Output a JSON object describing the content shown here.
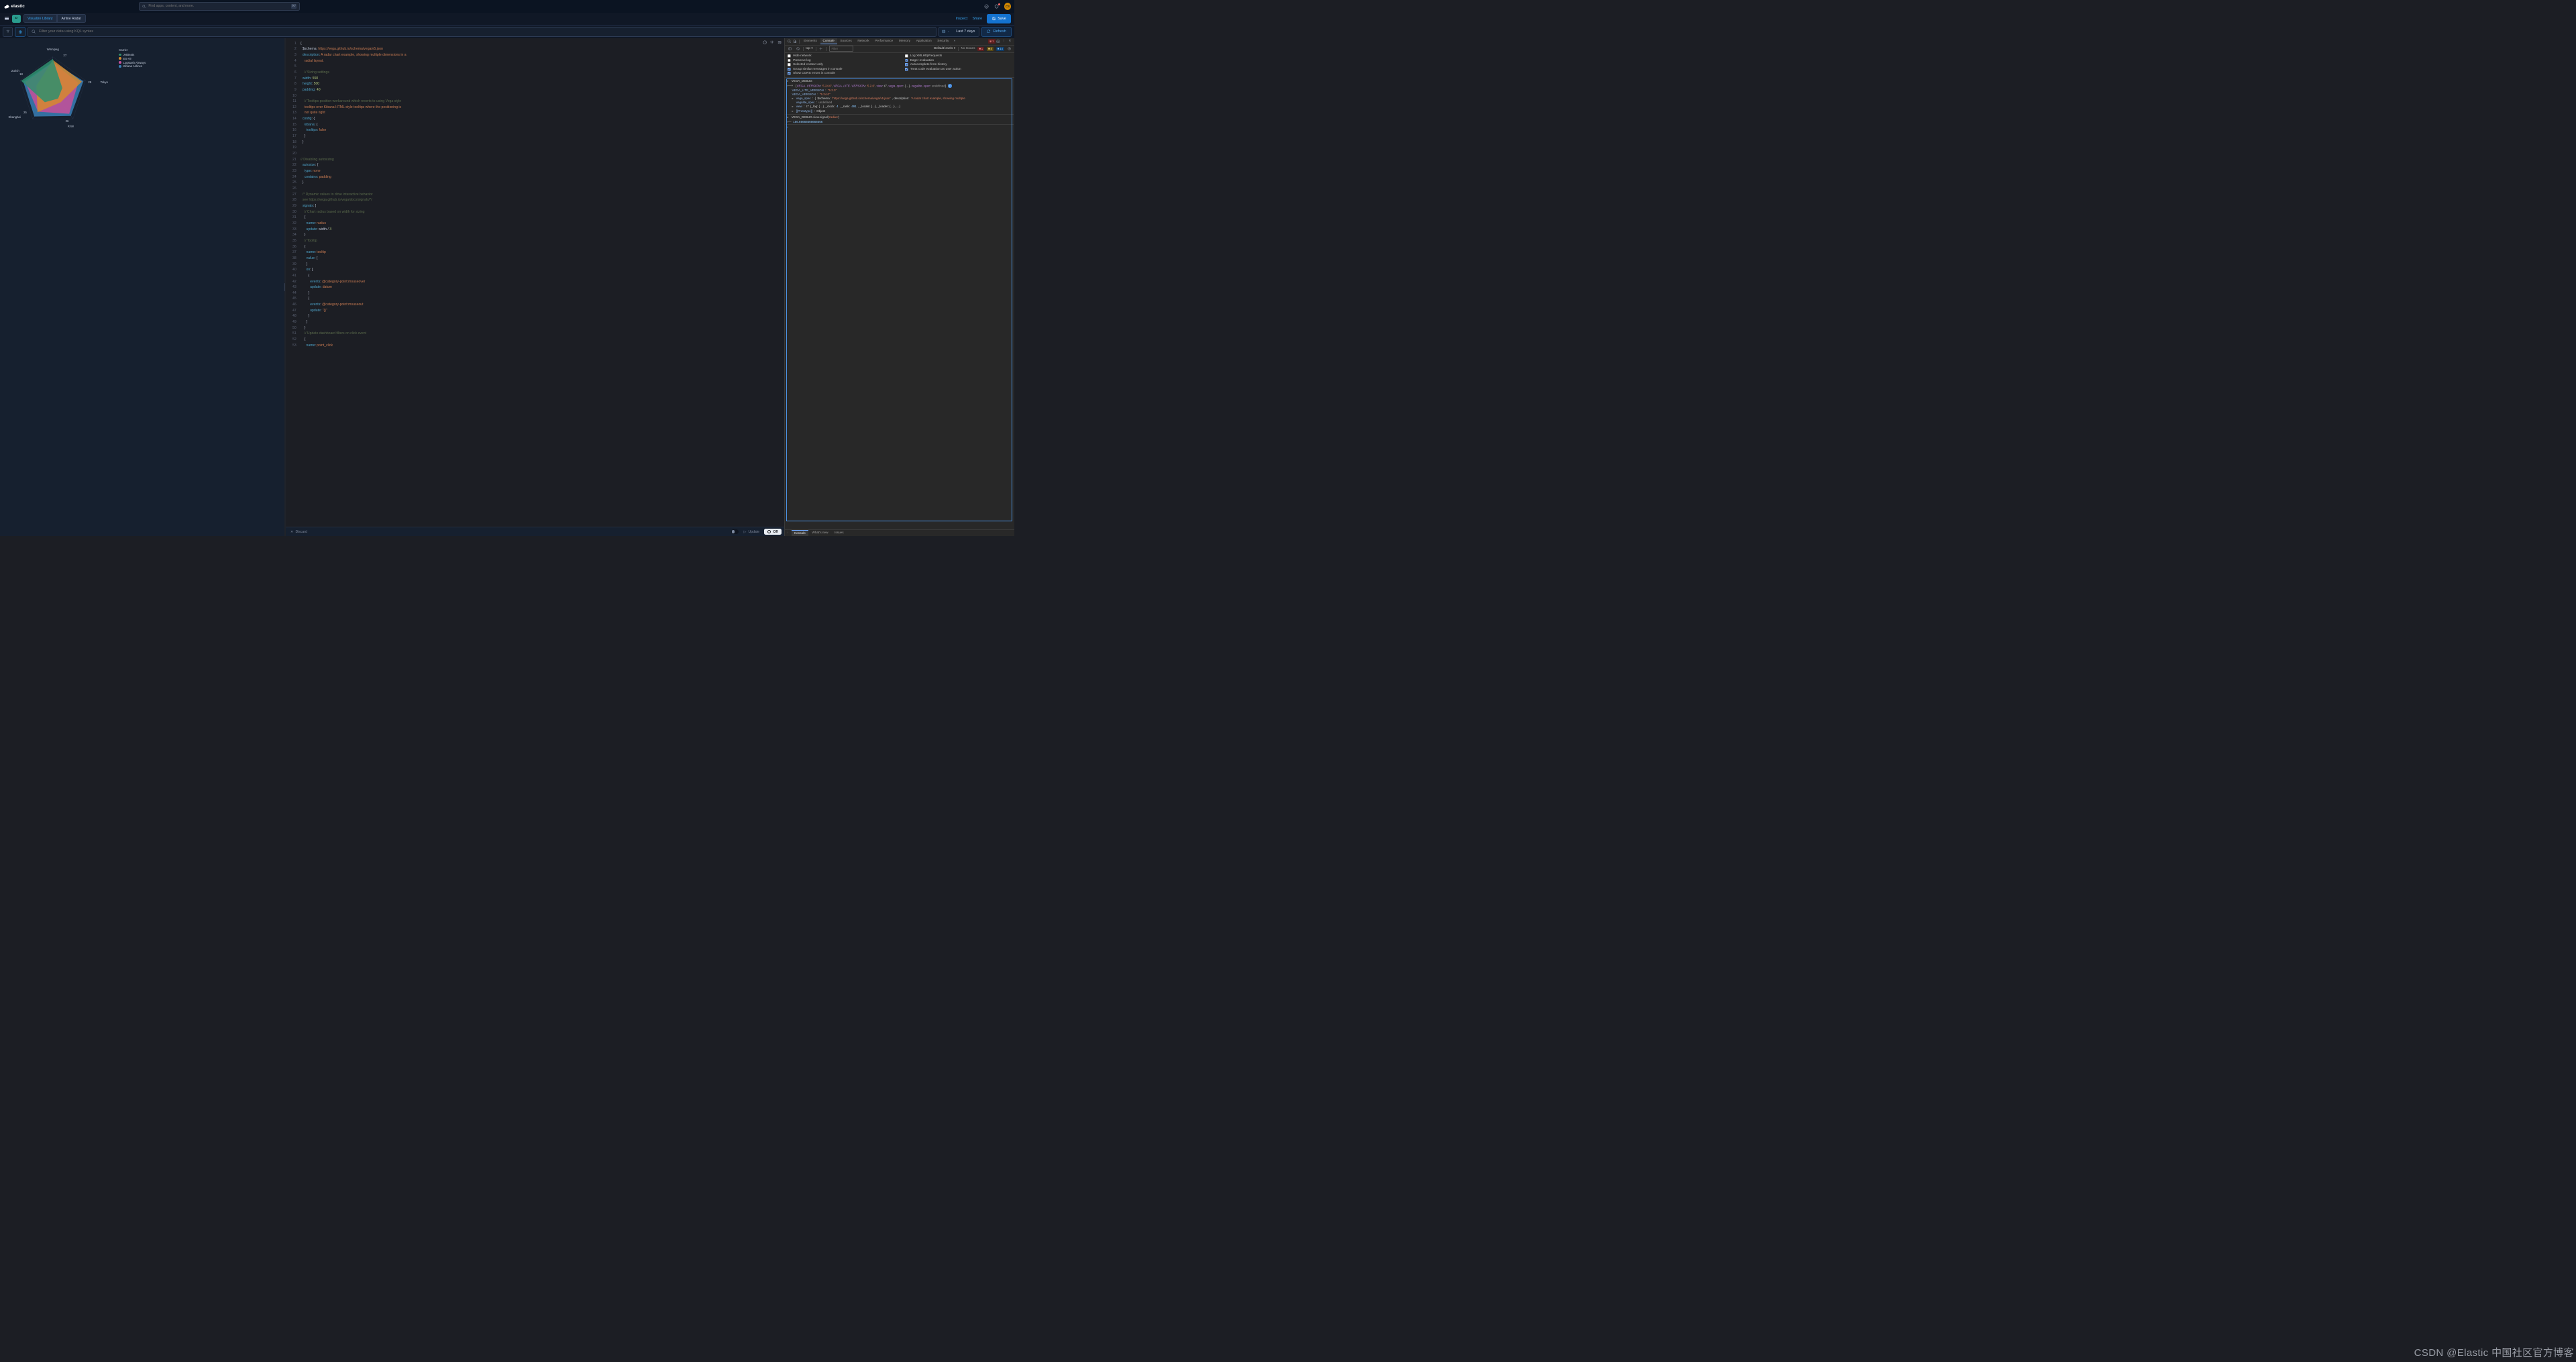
{
  "header": {
    "logo_text": "elastic",
    "search_placeholder": "Find apps, content, and more.",
    "search_kbd": "⌘/",
    "avatar_initials": "CS"
  },
  "subheader": {
    "d_label": "D",
    "crumbs": [
      "Visualize Library",
      "Airline Radar"
    ],
    "inspect": "Inspect",
    "share": "Share",
    "save": "Save"
  },
  "filterbar": {
    "kql_placeholder": "Filter your data using KQL syntax",
    "date_range": "Last 7 days",
    "refresh": "Refresh"
  },
  "chart_data": {
    "type": "radar",
    "title": "",
    "legend_title": "Carrier",
    "axes": [
      {
        "label": "Winnipeg",
        "value": 27
      },
      {
        "label": "Tokyo",
        "value": 28
      },
      {
        "label": "Xi'an",
        "value": 26
      },
      {
        "label": "Shanghai",
        "value": 25
      },
      {
        "label": "Zurich",
        "value": 18
      }
    ],
    "series": [
      {
        "name": "JetBeats",
        "color": "#2f8f6e"
      },
      {
        "name": "ES-Air",
        "color": "#d68a2e"
      },
      {
        "name": "Logstash Airways",
        "color": "#c94f9a"
      },
      {
        "name": "Kibana Airlines",
        "color": "#3a7fb6"
      }
    ]
  },
  "editor": {
    "lines": [
      "{",
      "  $schema: https://vega.github.io/schema/vega/v5.json",
      "  description: A radar chart example, showing multiple dimensions in a",
      "    radial layout.",
      "",
      "    // Sizing settings",
      "  width: 550",
      "  height: 500",
      "  padding: 40",
      "",
      "    // Tooltips position workaround which reverts to using Vega style",
      "    tooltips over Kibana HTML style tooltips where the positioning is",
      "    not quite right",
      "  config: {",
      "    kibana: {",
      "      tooltips: false",
      "    }",
      "  }",
      "",
      "",
      "// Disabling autosizing",
      "  autosize: {",
      "    type: none",
      "    contains: padding",
      "  }",
      "",
      "  /* Dynamic values to drive interactive behavior",
      "  see https://vega.github.io/vega/docs/signals/*/",
      "  signals: [",
      "    // Chart radius based on width for sizing",
      "    {",
      "      name: radius",
      "      update: width / 3",
      "    }",
      "    // Tooltip",
      "    {",
      "      name: tooltip",
      "      value: {",
      "      }",
      "      on: [",
      "        {",
      "          events: @category-point:mouseover",
      "          update: datum",
      "        }",
      "        {",
      "          events: @category-point:mouseout",
      "          update: \"{}\"",
      "        }",
      "      ]",
      "    }",
      "    // Update dashboard filters on click event",
      "    {",
      "      name: point_click"
    ]
  },
  "footer": {
    "discard": "Discard",
    "update": "Update",
    "off": "Off"
  },
  "devtools": {
    "tabs": [
      "Elements",
      "Console",
      "Sources",
      "Network",
      "Performance",
      "Memory",
      "Application",
      "Security"
    ],
    "active_tab": "Console",
    "errors": "1",
    "warnings": "4",
    "infos": "14",
    "context": "top",
    "filter_placeholder": "Filter",
    "levels": "Default levels",
    "no_issues": "No Issues",
    "opts_left": [
      {
        "label": "Hide network",
        "checked": false
      },
      {
        "label": "Preserve log",
        "checked": false
      },
      {
        "label": "Selected context only",
        "checked": false
      },
      {
        "label": "Group similar messages in console",
        "checked": true
      },
      {
        "label": "Show CORS errors in console",
        "checked": true
      }
    ],
    "opts_right": [
      {
        "label": "Log XMLHttpRequests",
        "checked": false
      },
      {
        "label": "Eager evaluation",
        "checked": true
      },
      {
        "label": "Autocomplete from history",
        "checked": true
      },
      {
        "label": "Treat code evaluation as user action",
        "checked": true
      }
    ],
    "console": {
      "root": "VEGA_DEBUG",
      "vega_version": "'5.24.0'",
      "vega_lite_version": "'5.2.0'",
      "undef": "undefined",
      "lite_line_label": "VEGA_LITE_VERSION",
      "lite_line_value": "\"5.2.0\"",
      "ver_line_label": "VEGA_VERSION",
      "ver_line_value": "\"5.24.0\"",
      "spec_schema": "'https://vega.github.io/schema/vega/v5.json'",
      "spec_desc": "'A radar chart example, showing multiple",
      "spec_lite_label": "vegalite_spec",
      "view_rank": "491",
      "view_clock": "4",
      "proto": "[[Prototype]]",
      "object": "Object",
      "expr_line": "VEGA_DEBUG.view.signal('radius')",
      "expr_result": "156.66666666666666"
    },
    "footer_tabs": [
      "Console",
      "What's new",
      "Issues"
    ]
  },
  "watermark": "CSDN @Elastic 中国社区官方博客"
}
